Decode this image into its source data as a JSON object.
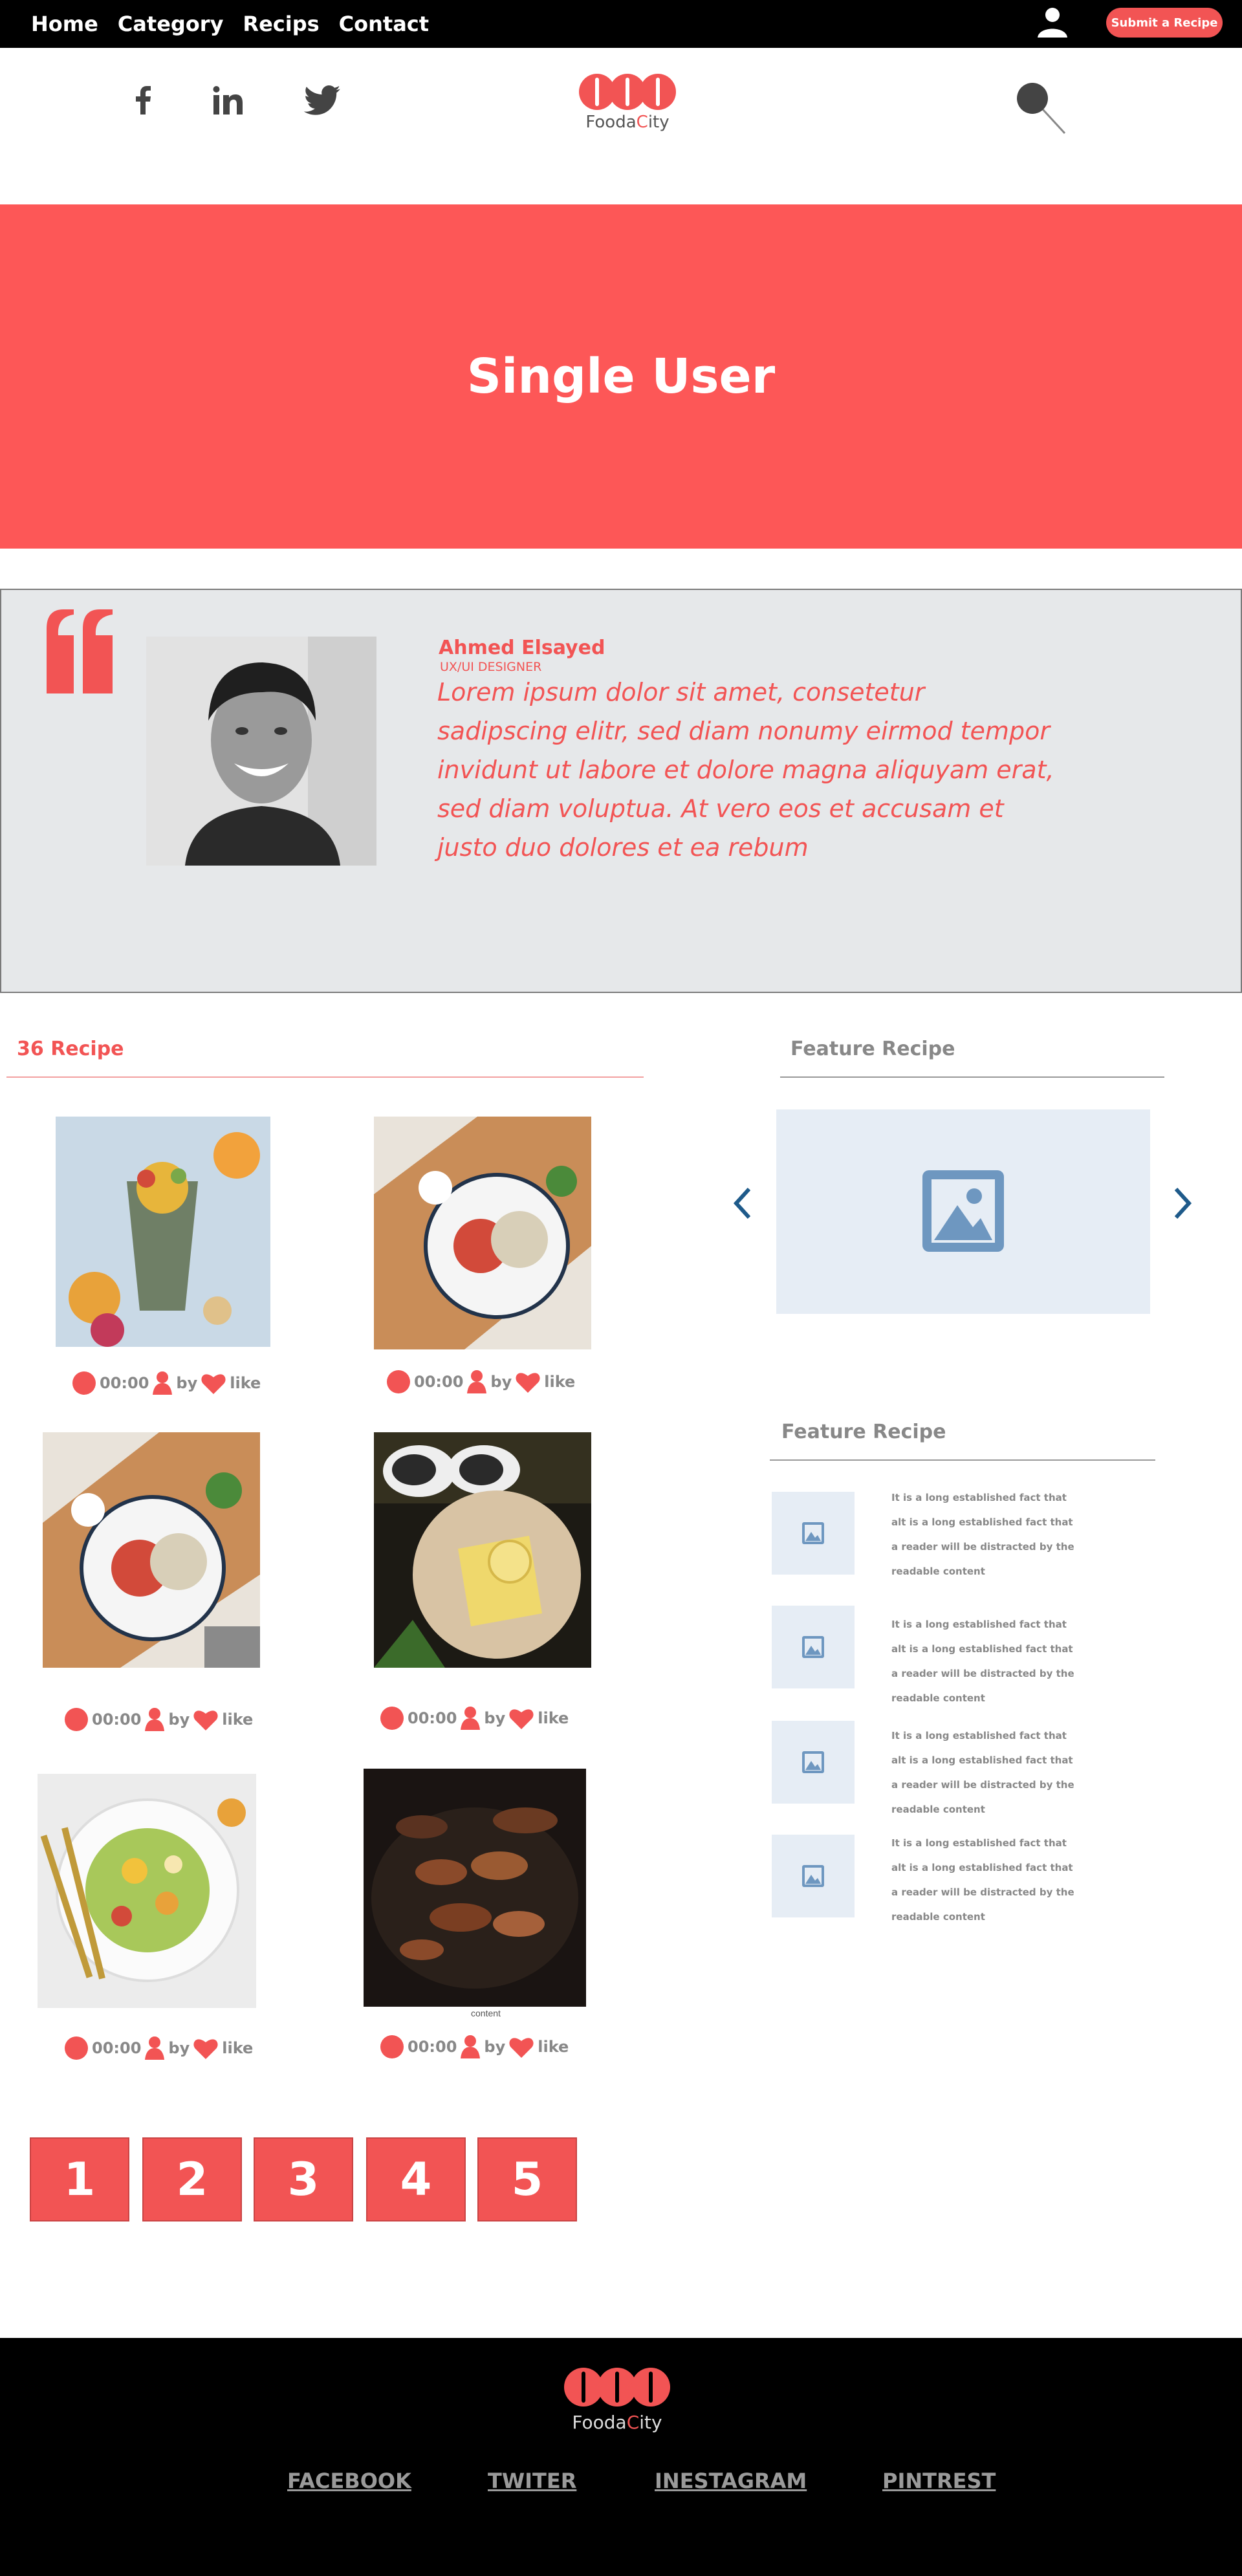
{
  "nav": {
    "links": [
      "Home",
      "Category",
      "Recips",
      "Contact"
    ],
    "submit_label": "Submit a Recipe"
  },
  "social": {
    "facebook_label": "f",
    "linkedin_label": "in"
  },
  "logo": {
    "part1": "Fooda",
    "part2": "C",
    "part3": "ity"
  },
  "hero": {
    "title": "Single User"
  },
  "profile": {
    "name": "Ahmed Elsayed",
    "role": "UX/UI DESIGNER",
    "bio": "Lorem ipsum dolor sit amet, consetetur sadipscing elitr, sed diam nonumy eirmod tempor invidunt ut labore et dolore magna aliquyam erat, sed diam voluptua. At vero eos et accusam et justo duo dolores et ea rebum"
  },
  "recipes": {
    "count_label": "36 Recipe",
    "meta": {
      "time": "00:00",
      "by": "by",
      "like": "like"
    },
    "content_caption": "content"
  },
  "featured": {
    "title1": "Feature Recipe",
    "title2": "Feature Recipe",
    "items": [
      {
        "text": "It is a long established fact that alt is a long established fact that a reader will be distracted by the readable content"
      },
      {
        "text": "It is a long established fact that alt is a long established fact that a reader will be distracted by the readable content"
      },
      {
        "text": "It is a long established fact that alt is a long established fact that a reader will be distracted by the readable content"
      },
      {
        "text": "It is a long established fact that alt is a long established fact that a reader will be distracted by the readable content"
      }
    ]
  },
  "pagination": [
    "1",
    "2",
    "3",
    "4",
    "5"
  ],
  "footer": {
    "links": [
      "FACEBOOK",
      "TWITER",
      "INESTAGRAM",
      "PINTREST"
    ]
  },
  "colors": {
    "accent": "#f25454",
    "hero": "#fd5757",
    "dark": "#000000",
    "panel": "#e6e8ea",
    "placeholder": "#e6edf5"
  }
}
